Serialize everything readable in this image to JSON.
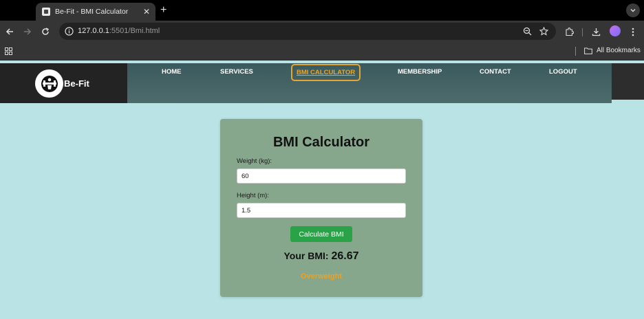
{
  "browser": {
    "tab_title": "Be-Fit - BMI Calculator",
    "url_host": "127.0.0.1",
    "url_rest": ":5501/Bmi.html",
    "all_bookmarks_label": "All Bookmarks"
  },
  "site": {
    "brand": "Be-Fit",
    "nav": [
      {
        "label": "HOME"
      },
      {
        "label": "SERVICES"
      },
      {
        "label": "BMI CALCULATOR",
        "active": true
      },
      {
        "label": "MEMBERSHIP"
      },
      {
        "label": "CONTACT"
      },
      {
        "label": "LOGOUT"
      }
    ]
  },
  "calculator": {
    "title": "BMI Calculator",
    "weight_label": "Weight (kg):",
    "weight_value": "60",
    "height_label": "Height (m):",
    "height_value": "1.5",
    "button_label": "Calculate BMI",
    "result_prefix": "Your BMI:",
    "result_value": "26.67",
    "category": "Overweight"
  },
  "colors": {
    "page_bg": "#b9e3e5",
    "card_bg": "#86a78c",
    "button_bg": "#2aa248",
    "accent_orange": "#e5a633",
    "category_color": "#f0a020"
  }
}
